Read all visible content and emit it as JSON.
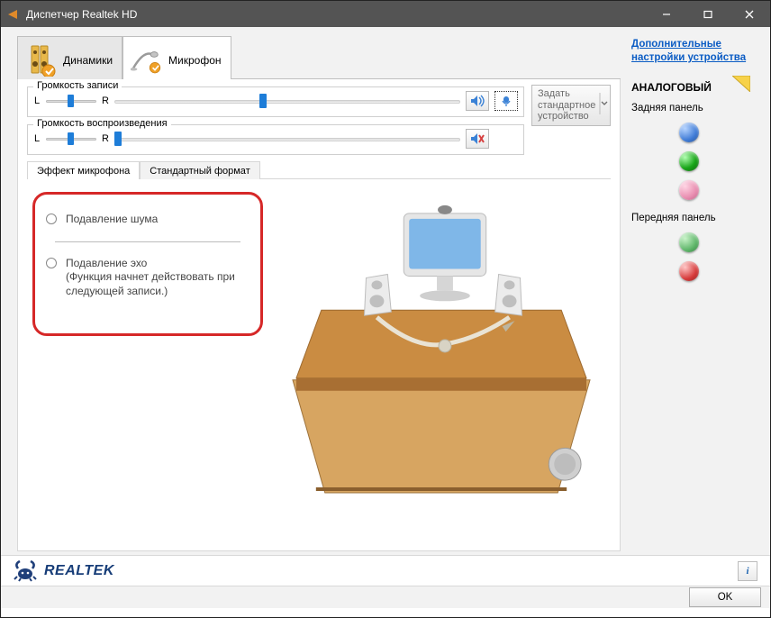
{
  "window": {
    "title": "Диспетчер Realtek HD"
  },
  "tabs": {
    "speakers": "Динамики",
    "microphone": "Микрофон"
  },
  "sliders": {
    "rec_legend": "Громкость записи",
    "play_legend": "Громкость воспроизведения",
    "L": "L",
    "R": "R"
  },
  "default_btn": "Задать стандартное устройство",
  "subtabs": {
    "effect": "Эффект микрофона",
    "format": "Стандартный формат"
  },
  "options": {
    "noise": "Подавление шума",
    "echo": "Подавление эхо",
    "echo_note": "(Функция начнет действовать при следующей записи.)"
  },
  "sidebar": {
    "adv_link": "Дополнительные настройки устройства",
    "analog": "АНАЛОГОВЫЙ",
    "back": "Задняя панель",
    "front": "Передняя панель"
  },
  "footer": {
    "brand": "REALTEK",
    "ok": "OK"
  }
}
